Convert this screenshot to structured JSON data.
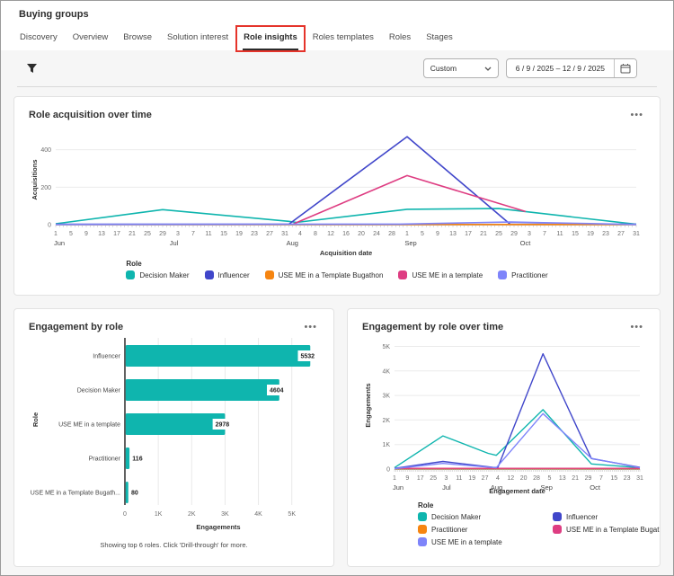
{
  "page": {
    "title": "Buying groups"
  },
  "tabs": {
    "items": [
      {
        "label": "Discovery"
      },
      {
        "label": "Overview"
      },
      {
        "label": "Browse"
      },
      {
        "label": "Solution interest"
      },
      {
        "label": "Role insights"
      },
      {
        "label": "Roles templates"
      },
      {
        "label": "Roles"
      },
      {
        "label": "Stages"
      }
    ],
    "active_label": "Role insights"
  },
  "filter": {
    "preset": {
      "value": "Custom"
    },
    "date_range": {
      "value": "6 / 9 / 2025  –  12 / 9 / 2025"
    }
  },
  "ui": {
    "more_options_glyph": "•••",
    "icons": {
      "filter": "funnel",
      "preset_chevron": "chevron-down",
      "date_picker": "calendar",
      "card_menu": "ellipsis"
    }
  },
  "colors": {
    "teal": "#0fb5ae",
    "blue": "#4046ca",
    "orange": "#f68511",
    "magenta": "#de3d82",
    "lavender": "#7e84fa",
    "annotation_red": "#e5342b"
  },
  "chart_data": [
    {
      "type": "line",
      "title": "Role acquisition over time",
      "xlabel": "Acquisition date",
      "ylabel": "Acquisitions",
      "x_domain": {
        "start": "Jun 1",
        "end": "Oct 31",
        "total_days": 152,
        "months": [
          [
            "Jun",
            0
          ],
          [
            "Jul",
            30
          ],
          [
            "Aug",
            61
          ],
          [
            "Sep",
            92
          ],
          [
            "Oct",
            122
          ]
        ],
        "month_lengths": [
          [
            "Jun",
            30
          ],
          [
            "Jul",
            31
          ],
          [
            "Aug",
            31
          ],
          [
            "Sep",
            30
          ],
          [
            "Oct",
            31
          ]
        ],
        "label_every_days": 4
      },
      "ylim": [
        0,
        480
      ],
      "yticks": [
        {
          "v": 0,
          "label": "0"
        },
        {
          "v": 200,
          "label": "200"
        },
        {
          "v": 400,
          "label": "400"
        }
      ],
      "legend_title": "Role",
      "legend_layout": "row",
      "series": [
        {
          "name": "Decision Maker",
          "color": "#0fb5ae",
          "points": [
            [
              0,
              5
            ],
            [
              28,
              80
            ],
            [
              61,
              18
            ],
            [
              63,
              12
            ],
            [
              92,
              82
            ],
            [
              116,
              86
            ],
            [
              152,
              2
            ]
          ]
        },
        {
          "name": "Influencer",
          "color": "#4046ca",
          "points": [
            [
              0,
              2
            ],
            [
              61,
              2
            ],
            [
              92,
              470
            ],
            [
              119,
              2
            ],
            [
              152,
              2
            ]
          ]
        },
        {
          "name": "USE ME in a Template Bugathon",
          "color": "#f68511",
          "points": [
            [
              0,
              1
            ],
            [
              152,
              1
            ]
          ]
        },
        {
          "name": "USE ME in a template",
          "color": "#de3d82",
          "points": [
            [
              62,
              2
            ],
            [
              92,
              262
            ],
            [
              123,
              70
            ]
          ]
        },
        {
          "name": "Practitioner",
          "color": "#7e84fa",
          "points": [
            [
              0,
              1
            ],
            [
              90,
              3
            ],
            [
              119,
              14
            ],
            [
              140,
              6
            ],
            [
              152,
              1
            ]
          ]
        }
      ]
    },
    {
      "type": "bar",
      "title": "Engagement by role",
      "xlabel": "Engagements",
      "ylabel": "Role",
      "categories": [
        "Influencer",
        "Decision Maker",
        "USE ME in a template",
        "Practitioner",
        "USE ME in a Template Bugath..."
      ],
      "values": [
        5532,
        4604,
        2978,
        116,
        80
      ],
      "bar_color": "#0fb5ae",
      "xlim": [
        0,
        5600
      ],
      "xticks": [
        {
          "v": 0,
          "label": "0"
        },
        {
          "v": 1000,
          "label": "1K"
        },
        {
          "v": 2000,
          "label": "2K"
        },
        {
          "v": 3000,
          "label": "3K"
        },
        {
          "v": 4000,
          "label": "4K"
        },
        {
          "v": 5000,
          "label": "5K"
        }
      ],
      "footnote": "Showing top 6 roles. Click 'Drill-through' for more."
    },
    {
      "type": "line",
      "title": "Engagement by role over time",
      "xlabel": "Engagement date",
      "ylabel": "Engagements",
      "x_domain": {
        "start": "Jun 1",
        "end": "Oct 31",
        "total_days": 152,
        "months": [
          [
            "Jun",
            0
          ],
          [
            "Jul",
            30
          ],
          [
            "Aug",
            61
          ],
          [
            "Sep",
            92
          ],
          [
            "Oct",
            122
          ]
        ],
        "month_lengths": [
          [
            "Jun",
            30
          ],
          [
            "Jul",
            31
          ],
          [
            "Aug",
            31
          ],
          [
            "Sep",
            30
          ],
          [
            "Oct",
            31
          ]
        ],
        "label_every_days": 8
      },
      "ylim": [
        0,
        5200
      ],
      "yticks": [
        {
          "v": 0,
          "label": "0"
        },
        {
          "v": 1000,
          "label": "1K"
        },
        {
          "v": 2000,
          "label": "2K"
        },
        {
          "v": 3000,
          "label": "3K"
        },
        {
          "v": 4000,
          "label": "4K"
        },
        {
          "v": 5000,
          "label": "5K"
        }
      ],
      "legend_title": "Role",
      "legend_layout": "grid-2",
      "series": [
        {
          "name": "Decision Maker",
          "color": "#0fb5ae",
          "points": [
            [
              0,
              60
            ],
            [
              30,
              1350
            ],
            [
              58,
              640
            ],
            [
              63,
              560
            ],
            [
              92,
              2420
            ],
            [
              122,
              210
            ],
            [
              152,
              60
            ]
          ]
        },
        {
          "name": "Influencer",
          "color": "#4046ca",
          "points": [
            [
              0,
              30
            ],
            [
              30,
              310
            ],
            [
              61,
              70
            ],
            [
              64,
              60
            ],
            [
              92,
              4700
            ],
            [
              122,
              430
            ],
            [
              152,
              70
            ]
          ]
        },
        {
          "name": "Practitioner",
          "color": "#f68511",
          "points": [
            [
              0,
              15
            ],
            [
              152,
              15
            ]
          ]
        },
        {
          "name": "USE ME in a Template Bugathon",
          "color": "#de3d82",
          "points": [
            [
              0,
              30
            ],
            [
              152,
              30
            ]
          ]
        },
        {
          "name": "USE ME in a template",
          "color": "#7e84fa",
          "points": [
            [
              0,
              20
            ],
            [
              30,
              230
            ],
            [
              63,
              50
            ],
            [
              92,
              2260
            ],
            [
              122,
              440
            ],
            [
              152,
              55
            ]
          ]
        }
      ]
    }
  ]
}
